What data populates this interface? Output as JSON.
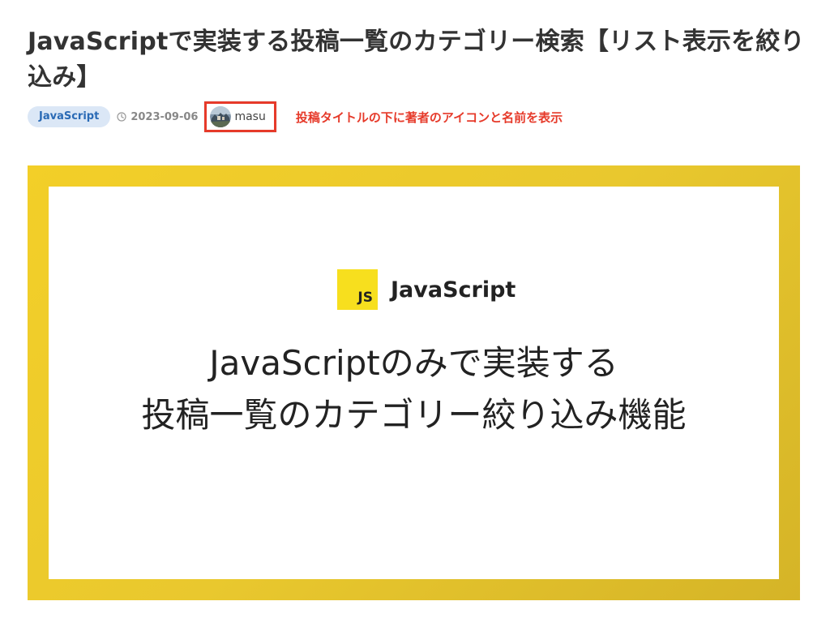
{
  "post": {
    "title": "JavaScriptで実装する投稿一覧のカテゴリー検索【リスト表示を絞り込み】",
    "category": "JavaScript",
    "date": "2023-09-06",
    "author": "masu",
    "annotation": "投稿タイトルの下に著者のアイコンと名前を表示"
  },
  "thumbnail": {
    "logo_text": "JS",
    "logo_label": "JavaScript",
    "headline_line1": "JavaScriptのみで実装する",
    "headline_line2": "投稿一覧のカテゴリー絞り込み機能"
  },
  "icons": {
    "clock": "clock-icon",
    "avatar": "avatar"
  },
  "colors": {
    "badge_bg": "#dbe7f6",
    "badge_text": "#2a6ab5",
    "annotation_red": "#e63a2a",
    "frame_yellow": "#f3cf28",
    "js_yellow": "#f7df1e"
  }
}
